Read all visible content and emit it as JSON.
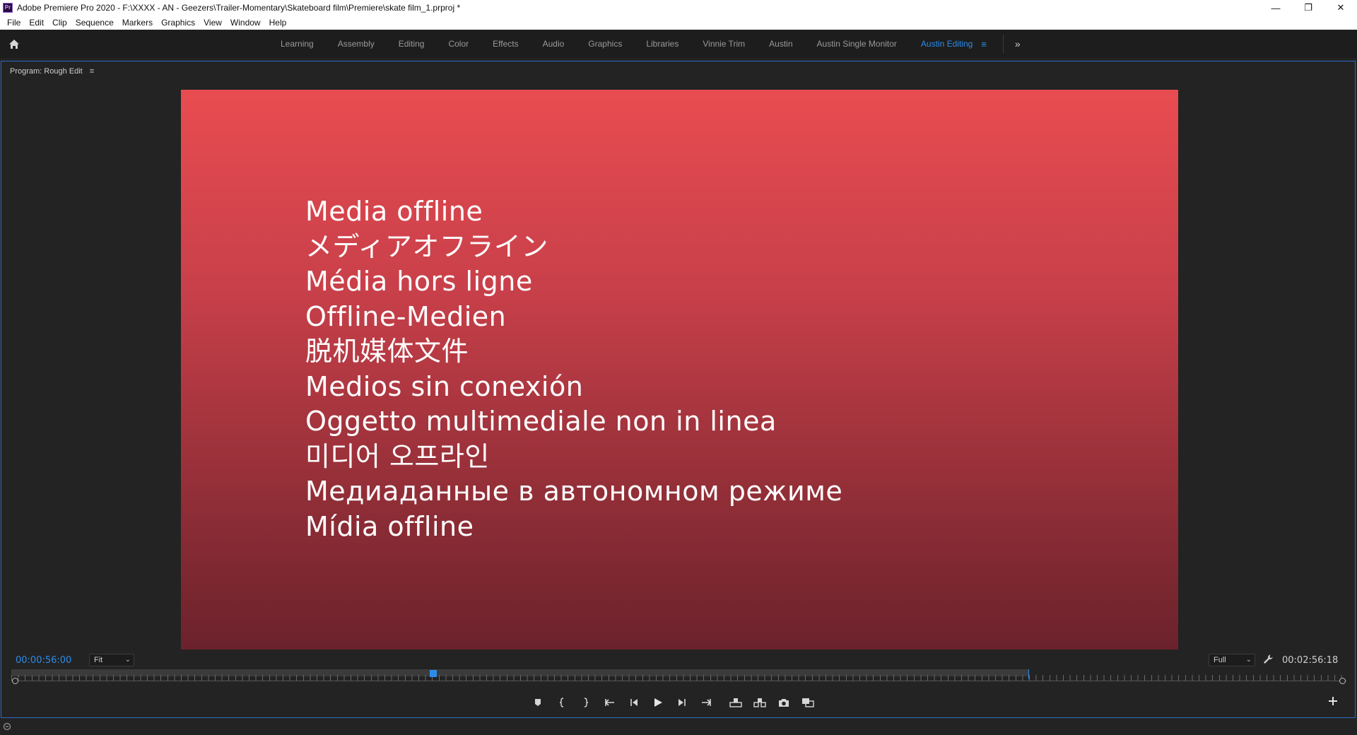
{
  "titlebar": {
    "app_icon": "Pr",
    "title": "Adobe Premiere Pro 2020 - F:\\XXXX - AN - Geezers\\Trailer-Momentary\\Skateboard film\\Premiere\\skate film_1.prproj *",
    "minimize": "—",
    "restore": "❐",
    "close": "✕"
  },
  "menubar": {
    "items": [
      "File",
      "Edit",
      "Clip",
      "Sequence",
      "Markers",
      "Graphics",
      "View",
      "Window",
      "Help"
    ]
  },
  "workspaces": {
    "tabs": [
      "Learning",
      "Assembly",
      "Editing",
      "Color",
      "Effects",
      "Audio",
      "Graphics",
      "Libraries",
      "Vinnie Trim",
      "Austin",
      "Austin Single Monitor",
      "Austin Editing"
    ],
    "active": "Austin Editing",
    "menu_glyph": "≡",
    "overflow": "»",
    "accent_color": "#2d8ceb"
  },
  "panel": {
    "title": "Program: Rough Edit",
    "menu_glyph": "≡"
  },
  "video": {
    "offline_lines": [
      "Media offline",
      "メディアオフライン",
      "Média hors ligne",
      "Offline-Medien",
      "脱机媒体文件",
      "Medios sin conexión",
      "Oggetto multimediale non in linea",
      "미디어 오프라인",
      "Медиаданные в автономном режиме",
      "Mídia offline"
    ],
    "gradient_top": "#e84c50",
    "gradient_bottom": "#6b222c"
  },
  "controls": {
    "playhead_timecode": "00:00:56:00",
    "duration_timecode": "00:02:56:18",
    "zoom_select": "Fit",
    "resolution_select": "Full",
    "playhead_position_fraction": 0.316
  },
  "icons": {
    "home": "home-icon",
    "wrench": "wrench-icon",
    "add": "plus-icon"
  }
}
